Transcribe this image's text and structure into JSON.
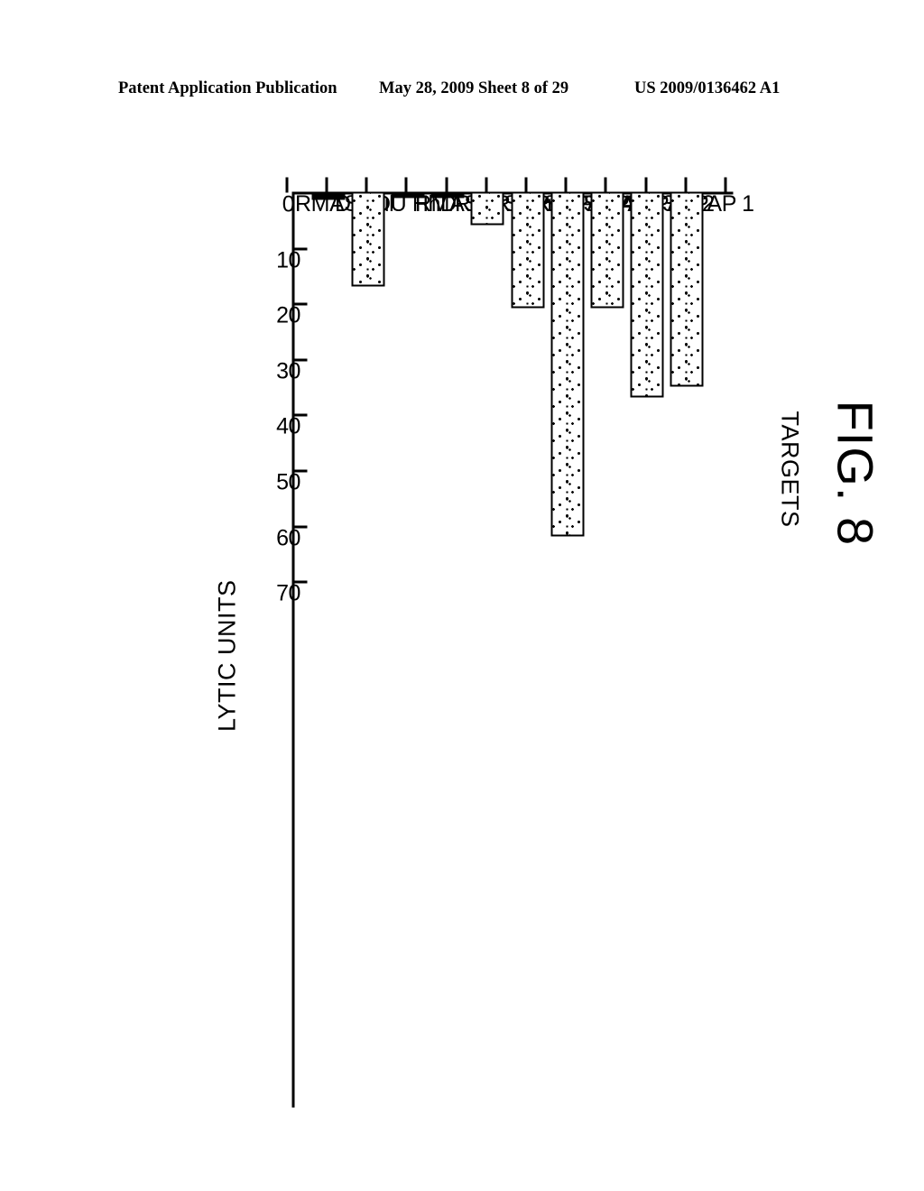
{
  "patent_header": {
    "publication": "Patent Application Publication",
    "date_sheet": "May 28, 2009  Sheet 8 of 29",
    "document_number": "US 2009/0136462 A1"
  },
  "figure": {
    "caption": "FIG. 8"
  },
  "chart_data": {
    "type": "bar",
    "orientation": "horizontal",
    "title": "FIG. 8",
    "xlabel": "LYTIC UNITS",
    "ylabel": "TARGETS",
    "categories": [
      "PAP 1",
      "PAP 2",
      "PAP 3",
      "PAP 4",
      "RMAS CAP",
      "RMAS HP",
      "RMAS Tyr",
      "RMAS Br.",
      "DU HhD",
      "DU",
      "RMAS nul"
    ],
    "values": [
      35,
      37,
      21,
      62,
      21,
      6,
      0.5,
      0.5,
      17,
      1.5,
      0
    ],
    "value_axis_ticks": [
      0,
      10,
      20,
      30,
      40,
      50,
      60,
      70
    ],
    "value_axis_range": [
      0,
      70
    ],
    "grid": false,
    "legend": false,
    "bar_style": {
      "fill": "stippled-dots",
      "fill_color": "#ffffff",
      "dot_color": "#000000",
      "border_color": "#000000"
    }
  }
}
